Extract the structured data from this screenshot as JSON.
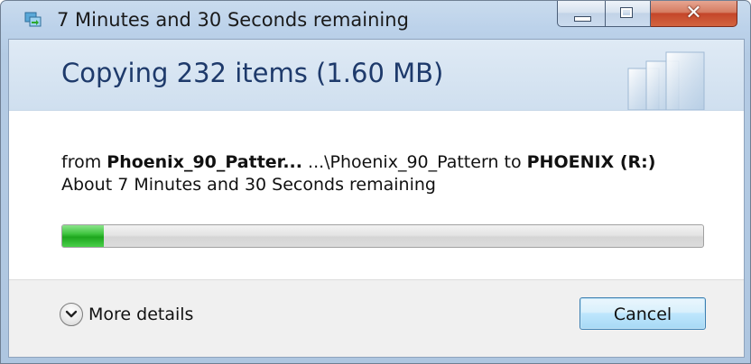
{
  "window": {
    "title": "7 Minutes and 30 Seconds remaining"
  },
  "header": {
    "title": "Copying 232 items (1.60 MB)"
  },
  "details": {
    "from_prefix": "from ",
    "source_name": "Phoenix_90_Patter...",
    "path": " ...\\Phoenix_90_Pattern to ",
    "destination": "PHOENIX (R:)",
    "time_remaining": "About 7 Minutes and 30 Seconds remaining"
  },
  "progress": {
    "fraction": 0.065,
    "color": "#2fbf2f"
  },
  "footer": {
    "more_details_label": "More details",
    "cancel_label": "Cancel"
  },
  "icons": {
    "app": "copy-files-icon",
    "minimize": "minimize-icon",
    "maximize": "maximize-icon",
    "close": "close-icon",
    "expand": "chevron-down-icon",
    "header": "document-pages-icon"
  }
}
